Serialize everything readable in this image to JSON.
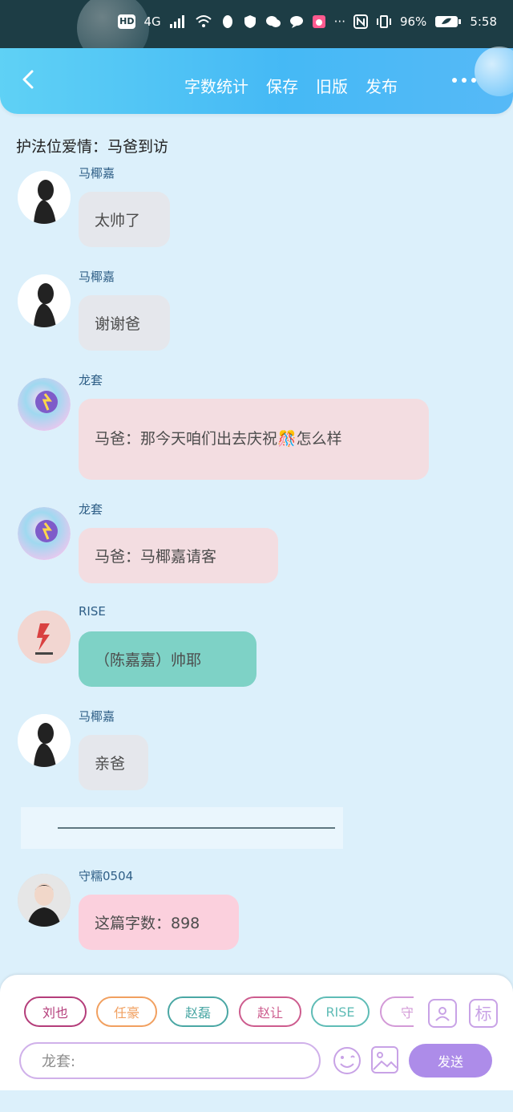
{
  "status_bar": {
    "hd": "HD",
    "net": "4G",
    "battery": "96%",
    "time": "5:58"
  },
  "header": {
    "actions": [
      "字数统计",
      "保存",
      "旧版",
      "发布"
    ]
  },
  "title": "护法位爱情：马爸到访",
  "messages": [
    {
      "name": "马椰嘉",
      "text": "太帅了",
      "bubble_color": "#e5e7ec",
      "avatar": "man-silhouette"
    },
    {
      "name": "马椰嘉",
      "text": "谢谢爸",
      "bubble_color": "#e5e7ec",
      "avatar": "man-silhouette"
    },
    {
      "name": "龙套",
      "text": "马爸：那今天咱们出去庆祝🎊怎么样",
      "bubble_color": "#f3dde1",
      "avatar": "nebula-orb"
    },
    {
      "name": "龙套",
      "text": "马爸：马椰嘉请客",
      "bubble_color": "#f3dde1",
      "avatar": "nebula-orb"
    },
    {
      "name": "RISE",
      "text": "（陈嘉嘉）帅耶",
      "bubble_color": "#7ed2c6",
      "avatar": "rise-logo"
    },
    {
      "name": "马椰嘉",
      "text": "亲爸",
      "bubble_color": "#e5e7ec",
      "avatar": "man-silhouette"
    },
    {
      "name": "守糯0504",
      "text": "这篇字数：898",
      "bubble_color": "#fbd0dd",
      "avatar": "portrait"
    }
  ],
  "separator": "———————————————",
  "composer": {
    "chips": [
      {
        "label": "刘也",
        "color": "#b43d7a"
      },
      {
        "label": "任豪",
        "color": "#f1a060"
      },
      {
        "label": "赵磊",
        "color": "#4aa7a4"
      },
      {
        "label": "赵让",
        "color": "#cd5c8e"
      },
      {
        "label": "RISE",
        "color": "#5fbcb6"
      },
      {
        "label": "守",
        "color": "#d39ad7"
      }
    ],
    "biao": "标",
    "input_value": "龙套:",
    "send": "发送"
  },
  "colors": {
    "background": "#dcf0fb",
    "header_start": "#5fd1f5",
    "header_end": "#56b9f7",
    "send_button": "#ad8ce9"
  }
}
